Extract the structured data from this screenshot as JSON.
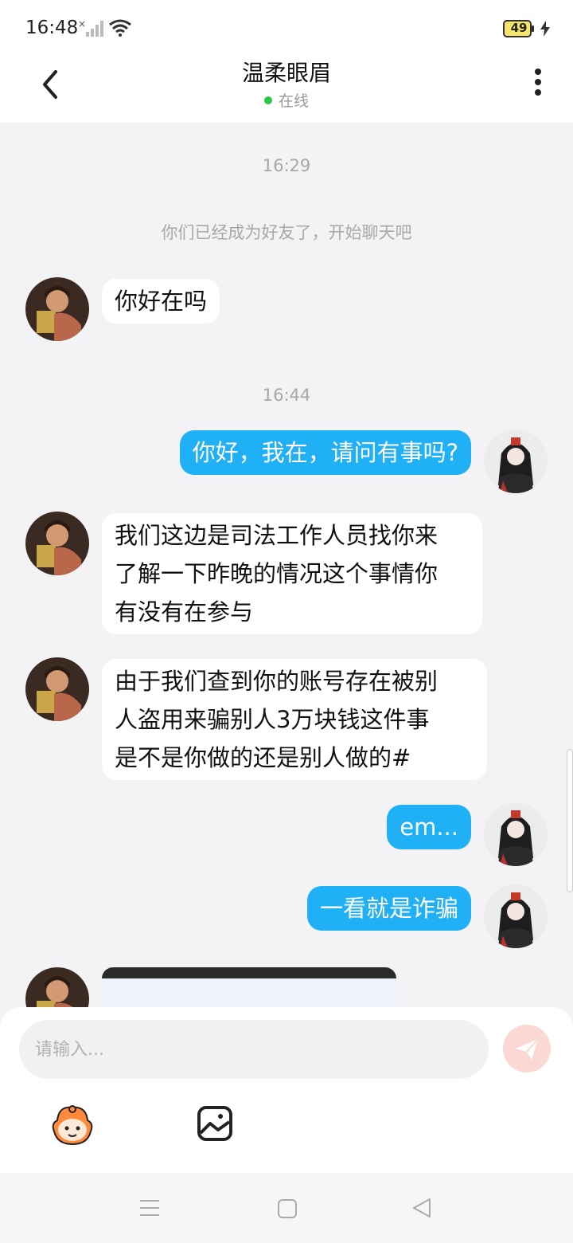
{
  "status_bar": {
    "time": "16:48",
    "battery": "49",
    "icons": [
      "signal-icon",
      "wifi-icon",
      "battery-icon",
      "charging-icon"
    ]
  },
  "header": {
    "title": "温柔眼眉",
    "status": "在线",
    "status_color": "#2bc84a",
    "icons": [
      "back-arrow-icon",
      "more-vertical-icon"
    ]
  },
  "chat": {
    "time_1": "16:29",
    "system_message": "你们已经成为好友了，开始聊天吧",
    "msg_1": "你好在吗",
    "time_2": "16:44",
    "msg_2": "你好，我在，请问有事吗?",
    "msg_3_lines": [
      "我们这边是司法工作人员找你来",
      "了解一下昨晚的情况这个事情你",
      "有没有在参与"
    ],
    "msg_4_lines": [
      "由于我们查到你的账号存在被别",
      "人盗用来骗别人3万块钱这件事",
      "是不是你做的还是别人做的#"
    ],
    "msg_5": "em...",
    "msg_6": "一看就是诈骗",
    "outgoing_bubble_color": "#1fb0f5"
  },
  "input": {
    "placeholder": "请输入...",
    "icons": [
      "send-icon",
      "emoji-icon",
      "image-icon"
    ]
  },
  "nav": {
    "icons": [
      "menu-icon",
      "home-icon",
      "back-icon"
    ]
  }
}
